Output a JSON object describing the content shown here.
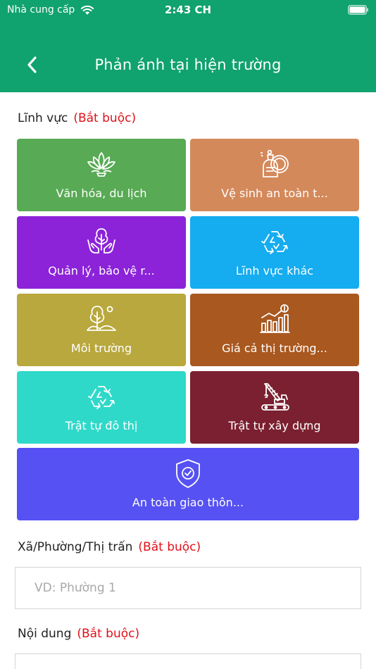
{
  "status_bar": {
    "carrier": "Nhà cung cấp",
    "time": "2:43 CH"
  },
  "header": {
    "title": "Phản ánh tại hiện trường"
  },
  "field_section": {
    "label": "Lĩnh vực",
    "required": "(Bắt buộc)",
    "tiles": [
      {
        "label": "Văn hóa, du lịch",
        "icon": "lotus-icon",
        "color": "#58aa54"
      },
      {
        "label": "Vệ sinh an toàn t...",
        "icon": "food-safety-icon",
        "color": "#d4895a"
      },
      {
        "label": "Quản lý, bảo vệ r...",
        "icon": "forest-protection-icon",
        "color": "#8c23d8"
      },
      {
        "label": "Lĩnh vực khác",
        "icon": "recycle-icon",
        "color": "#15acf0"
      },
      {
        "label": "Môi trường",
        "icon": "environment-icon",
        "color": "#b8a83d"
      },
      {
        "label": "Giá cả thị trường...",
        "icon": "market-price-icon",
        "color": "#a9581f"
      },
      {
        "label": "Trật tự đô thị",
        "icon": "recycle-icon",
        "color": "#2fd9c9"
      },
      {
        "label": "Trật tự xây dựng",
        "icon": "crane-icon",
        "color": "#7b2030"
      },
      {
        "label": "An toàn giao thôn...",
        "icon": "shield-icon",
        "color": "#5651f2"
      }
    ]
  },
  "ward_section": {
    "label": "Xã/Phường/Thị trấn",
    "required": "(Bắt buộc)",
    "placeholder": "VD: Phường 1",
    "value": ""
  },
  "content_section": {
    "label": "Nội dung",
    "required": "(Bắt buộc)"
  }
}
